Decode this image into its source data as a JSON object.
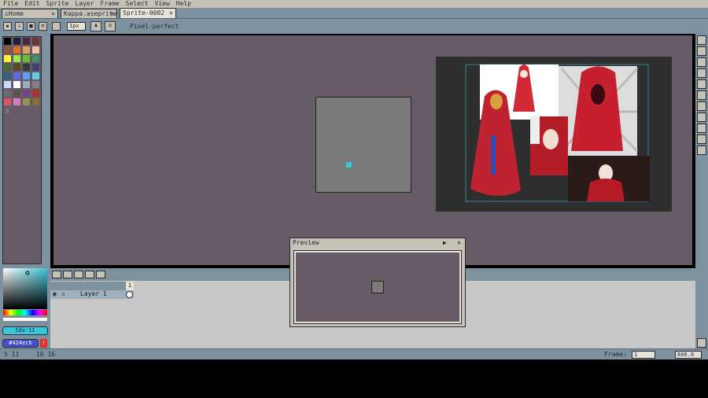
{
  "menu": [
    "File",
    "Edit",
    "Sprite",
    "Layer",
    "Frame",
    "Select",
    "View",
    "Help"
  ],
  "tabs": [
    {
      "label": "Home",
      "close": "×"
    },
    {
      "label": "Kappa.aseprite",
      "close": "×"
    },
    {
      "label": "Sprite-0002",
      "close": "×",
      "active": true
    }
  ],
  "context": {
    "brush_size": "1px",
    "pixel_perfect": "Pixel-perfect"
  },
  "palette_colors": [
    "#000000",
    "#222034",
    "#45283c",
    "#663931",
    "#8f563b",
    "#df7126",
    "#d9a066",
    "#eec39a",
    "#fbf236",
    "#99e550",
    "#6abe30",
    "#37946e",
    "#4b692f",
    "#524b24",
    "#323c39",
    "#3f3f74",
    "#306082",
    "#5b6ee1",
    "#639bff",
    "#5fcde4",
    "#cbdbfc",
    "#ffffff",
    "#9badb7",
    "#847e87",
    "#696a6a",
    "#595652",
    "#76428a",
    "#ac3232",
    "#d95763",
    "#d77bba",
    "#8f974a",
    "#8a6f30"
  ],
  "palette_index_label": "0",
  "color": {
    "index": "Idx-11",
    "hex": "#424ecb"
  },
  "timeline": {
    "layer_name": "Layer 1",
    "frame_header": "1"
  },
  "preview": {
    "title": "Preview"
  },
  "status": {
    "cursor": "5 11",
    "size": "16 16",
    "frame_label": "Frame:",
    "frame_value": "1",
    "zoom": "800.0"
  },
  "accent": "#3cc4d8"
}
